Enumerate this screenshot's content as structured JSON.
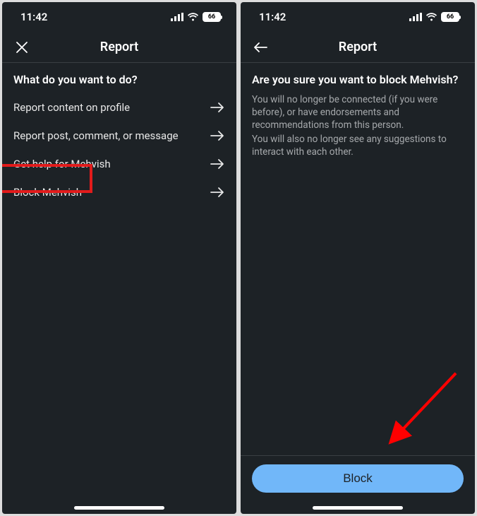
{
  "statusbar": {
    "time": "11:42",
    "battery": "66"
  },
  "screen1": {
    "title": "Report",
    "question": "What do you want to do?",
    "options": [
      "Report content on profile",
      "Report post, comment, or message",
      "Get help for Mehvish",
      "Block Mehvish"
    ]
  },
  "screen2": {
    "title": "Report",
    "heading": "Are you sure you want to block Mehvish?",
    "body1": "You will no longer be connected (if you were before), or have endorsements and recommendations from this person.",
    "body2": "You will also no longer see any suggestions to interact with each other.",
    "block_label": "Block"
  }
}
